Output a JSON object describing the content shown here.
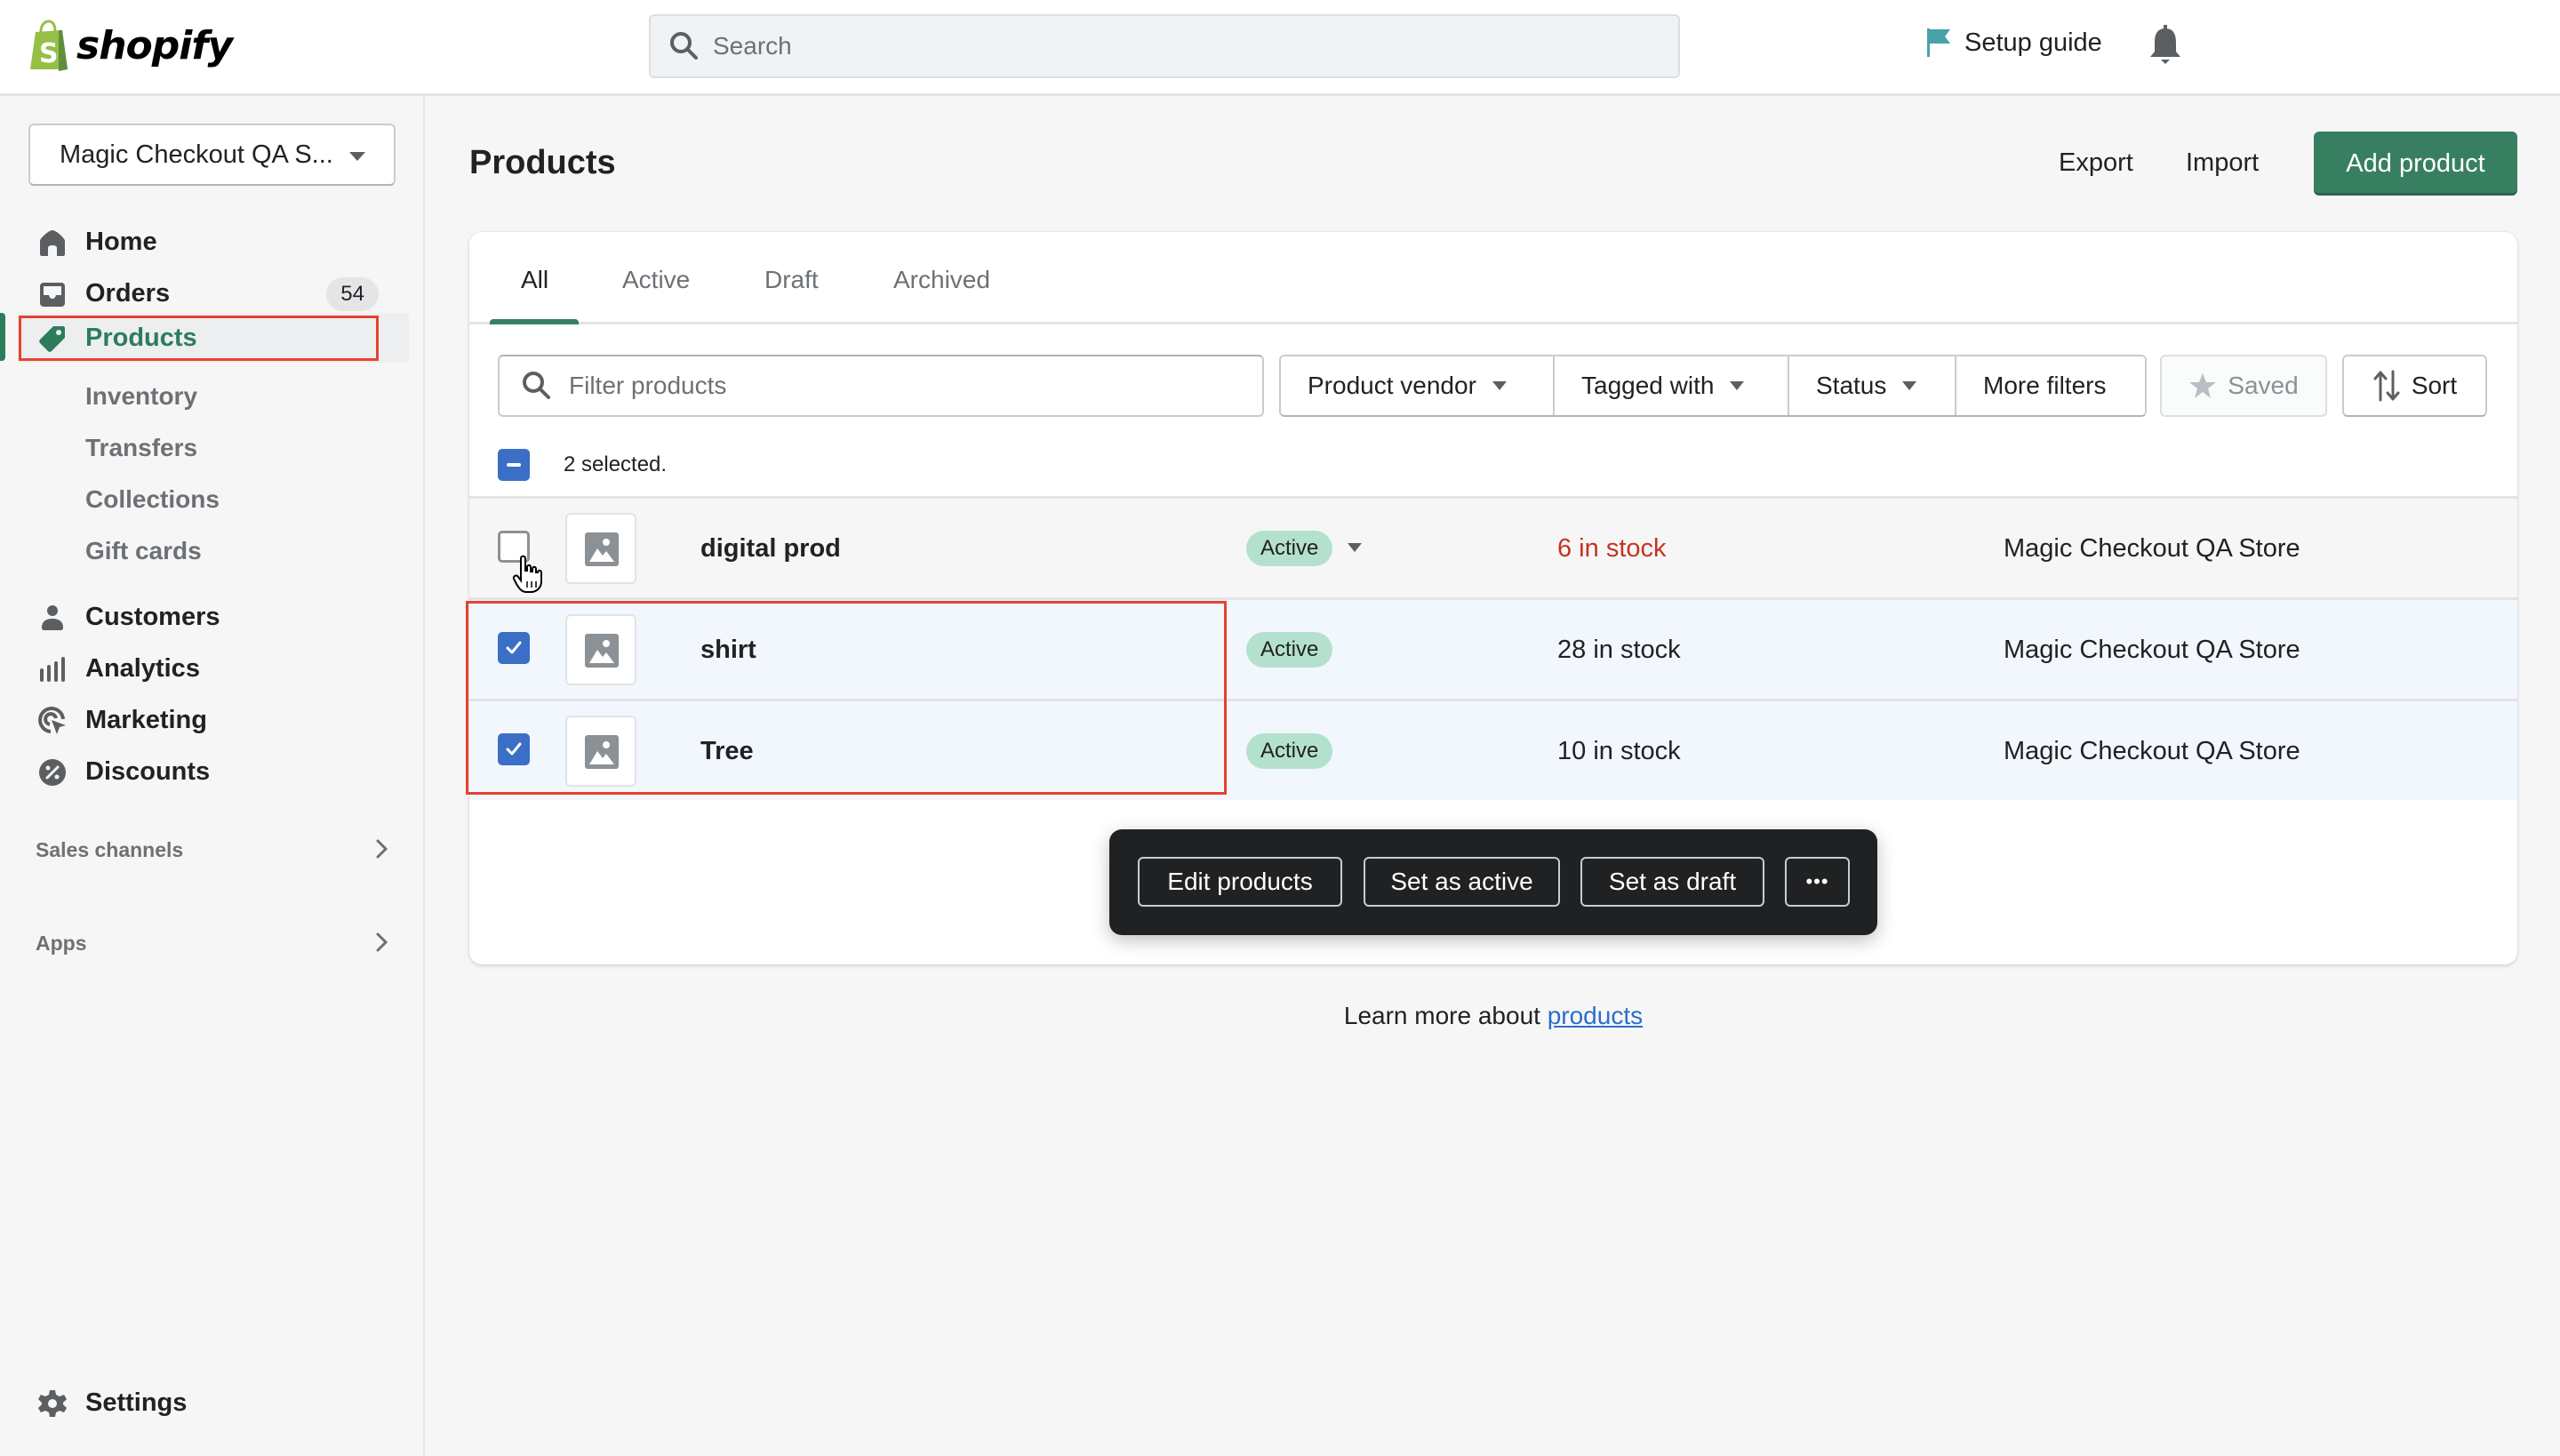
{
  "topbar": {
    "brand": "shopify",
    "search_placeholder": "Search",
    "setup_guide_label": "Setup guide",
    "icons": {
      "search": "search-icon",
      "flag": "flag-icon",
      "bell": "bell-icon"
    }
  },
  "sidebar": {
    "store_name": "Magic Checkout QA S...",
    "items": [
      {
        "label": "Home",
        "icon": "home-icon"
      },
      {
        "label": "Orders",
        "icon": "orders-icon",
        "badge": "54"
      },
      {
        "label": "Products",
        "icon": "tag-icon",
        "active": true
      },
      {
        "label": "Customers",
        "icon": "person-icon"
      },
      {
        "label": "Analytics",
        "icon": "bar-chart-icon"
      },
      {
        "label": "Marketing",
        "icon": "target-icon"
      },
      {
        "label": "Discounts",
        "icon": "discount-icon"
      }
    ],
    "product_subitems": [
      "Inventory",
      "Transfers",
      "Collections",
      "Gift cards"
    ],
    "sections": [
      {
        "label": "Sales channels"
      },
      {
        "label": "Apps"
      }
    ],
    "settings_label": "Settings"
  },
  "page": {
    "title": "Products",
    "export_label": "Export",
    "import_label": "Import",
    "add_product_label": "Add product",
    "accent_color": "#387f62"
  },
  "tabs": [
    {
      "label": "All",
      "active": true
    },
    {
      "label": "Active"
    },
    {
      "label": "Draft"
    },
    {
      "label": "Archived"
    }
  ],
  "filters": {
    "placeholder": "Filter products",
    "buttons": [
      "Product vendor",
      "Tagged with",
      "Status",
      "More filters"
    ],
    "saved_label": "Saved",
    "sort_label": "Sort"
  },
  "selection": {
    "text": "2 selected."
  },
  "products": [
    {
      "name": "digital prod",
      "status": "Active",
      "inventory": "6 in stock",
      "low_stock": true,
      "vendor": "Magic Checkout QA Store",
      "checked": false
    },
    {
      "name": "shirt",
      "status": "Active",
      "inventory": "28 in stock",
      "low_stock": false,
      "vendor": "Magic Checkout QA Store",
      "checked": true
    },
    {
      "name": "Tree",
      "status": "Active",
      "inventory": "10 in stock",
      "low_stock": false,
      "vendor": "Magic Checkout QA Store",
      "checked": true
    }
  ],
  "bulk_actions": {
    "edit": "Edit products",
    "set_active": "Set as active",
    "set_draft": "Set as draft",
    "more": "•••"
  },
  "footer": {
    "learn_more_prefix": "Learn more about ",
    "learn_more_link": "products"
  }
}
